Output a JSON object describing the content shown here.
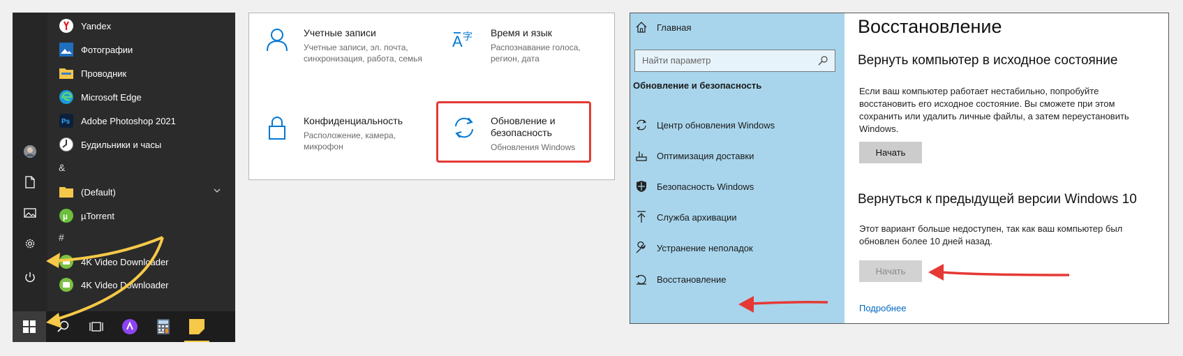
{
  "start_menu": {
    "apps": [
      {
        "label": "Yandex",
        "icon": "yandex-icon"
      },
      {
        "label": "Фотографии",
        "icon": "photos-icon"
      },
      {
        "label": "Проводник",
        "icon": "folder-icon"
      },
      {
        "label": "Microsoft Edge",
        "icon": "edge-icon"
      },
      {
        "label": "Adobe Photoshop 2021",
        "icon": "photoshop-icon"
      },
      {
        "label": "Будильники и часы",
        "icon": "clock-icon"
      },
      {
        "label": "&",
        "icon": ""
      },
      {
        "label": "(Default)",
        "icon": "folder-icon"
      },
      {
        "label": "µTorrent",
        "icon": "utorrent-icon"
      },
      {
        "label": "#",
        "icon": ""
      },
      {
        "label": "4K Video Downloader",
        "icon": "4k-downloader-icon"
      },
      {
        "label": "4K Video Downloader",
        "icon": "4k-downloader-icon"
      }
    ],
    "rail": [
      "avatar",
      "documents-icon",
      "pictures-icon",
      "settings-gear-icon",
      "power-icon"
    ],
    "taskbar": [
      "windows-start-icon",
      "search-icon",
      "task-view-icon",
      "alice-icon",
      "calculator-icon",
      "sticky-notes-icon"
    ]
  },
  "settings": {
    "tiles": [
      {
        "title": "Учетные записи",
        "desc": "Учетные записи, эл. почта, синхронизация, работа, семья"
      },
      {
        "title": "Время и язык",
        "desc": "Распознавание голоса, регион, дата"
      },
      {
        "title": "Конфиденциальность",
        "desc": "Расположение, камера, микрофон"
      },
      {
        "title": "Обновление и безопасность",
        "desc": "Обновления Windows"
      }
    ]
  },
  "recovery": {
    "sidebar": {
      "home": "Главная",
      "search_placeholder": "Найти параметр",
      "section": "Обновление и безопасность",
      "items": [
        "Центр обновления Windows",
        "Оптимизация доставки",
        "Безопасность Windows",
        "Служба архивации",
        "Устранение неполадок",
        "Восстановление"
      ]
    },
    "main": {
      "title": "Восстановление",
      "reset_heading": "Вернуть компьютер в исходное состояние",
      "reset_text": "Если ваш компьютер работает нестабильно, попробуйте восстановить его исходное состояние. Вы сможете при этом сохранить или удалить личные файлы, а затем переустановить Windows.",
      "reset_button": "Начать",
      "goback_heading": "Вернуться к предыдущей версии Windows 10",
      "goback_text": "Этот вариант больше недоступен, так как ваш компьютер был обновлен более 10 дней назад.",
      "goback_button": "Начать",
      "more_link": "Подробнее"
    }
  },
  "colors": {
    "accent_blue": "#0078d4",
    "sidebar_blue": "#a8d5ec",
    "annotation_red": "#e53935",
    "annotation_yellow": "#f7c948"
  }
}
